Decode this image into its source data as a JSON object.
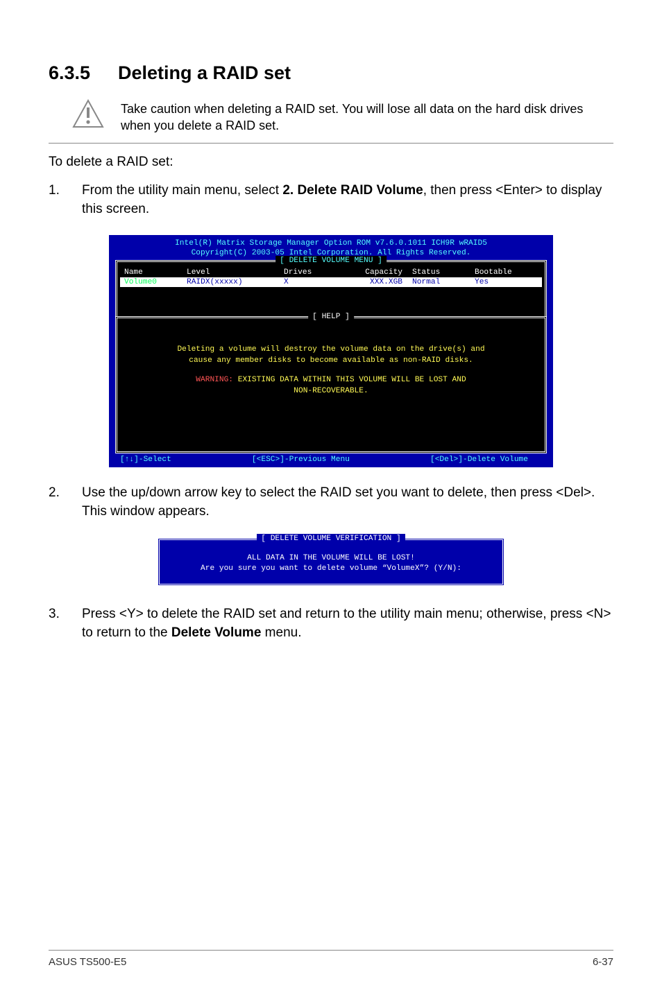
{
  "heading": {
    "num": "6.3.5",
    "title": "Deleting a RAID set"
  },
  "caution": "Take caution when deleting a RAID set. You will lose all data on the hard disk drives when you delete a RAID set.",
  "intro": "To delete a RAID set:",
  "step1": {
    "num": "1.",
    "pre": "From the utility main menu, select ",
    "bold": "2. Delete RAID Volume",
    "post": ", then press <Enter> to display this screen."
  },
  "bios": {
    "top1": "Intel(R) Matrix Storage Manager Option ROM v7.6.0.1011 ICH9R wRAID5",
    "top2": "Copyright(C) 2003-05 Intel Corporation. All Rights Reserved.",
    "menu_title": "[ DELETE VOLUME MENU ]",
    "hdr": {
      "name": "Name",
      "level": "Level",
      "drives": "Drives",
      "cap": "Capacity",
      "status": "Status",
      "boot": "Bootable"
    },
    "row": {
      "name": "Volume0",
      "level": "RAIDX(xxxxx)",
      "drives": "X",
      "cap": "XXX.XGB",
      "status": "Normal",
      "boot": "Yes"
    },
    "help_title": "[ HELP ]",
    "help1": "Deleting a volume will destroy the volume data on the drive(s) and",
    "help2": "cause any member disks to become available as non-RAID disks.",
    "warn_label": "WARNING:",
    "warn_text": " EXISTING DATA WITHIN THIS VOLUME WILL BE LOST AND",
    "warn2": "NON-RECOVERABLE.",
    "bottom_left": "[↑↓]-Select",
    "bottom_mid": "[<ESC>]-Previous Menu",
    "bottom_right": "[<Del>]-Delete Volume"
  },
  "step2": {
    "num": "2.",
    "text": "Use the up/down arrow key to select the RAID set you want to delete, then press <Del>. This window appears."
  },
  "dialog": {
    "title": "[ DELETE VOLUME VERIFICATION ]",
    "line1": "ALL DATA IN THE VOLUME WILL BE LOST!",
    "line2": "Are you sure you want to delete volume “VolumeX”? (Y/N):"
  },
  "step3": {
    "num": "3.",
    "pre": "Press <Y> to delete the RAID set and return to the utility main menu; otherwise, press <N> to return to the ",
    "bold": "Delete Volume",
    "post": " menu."
  },
  "footer": {
    "left": "ASUS TS500-E5",
    "right": "6-37"
  }
}
